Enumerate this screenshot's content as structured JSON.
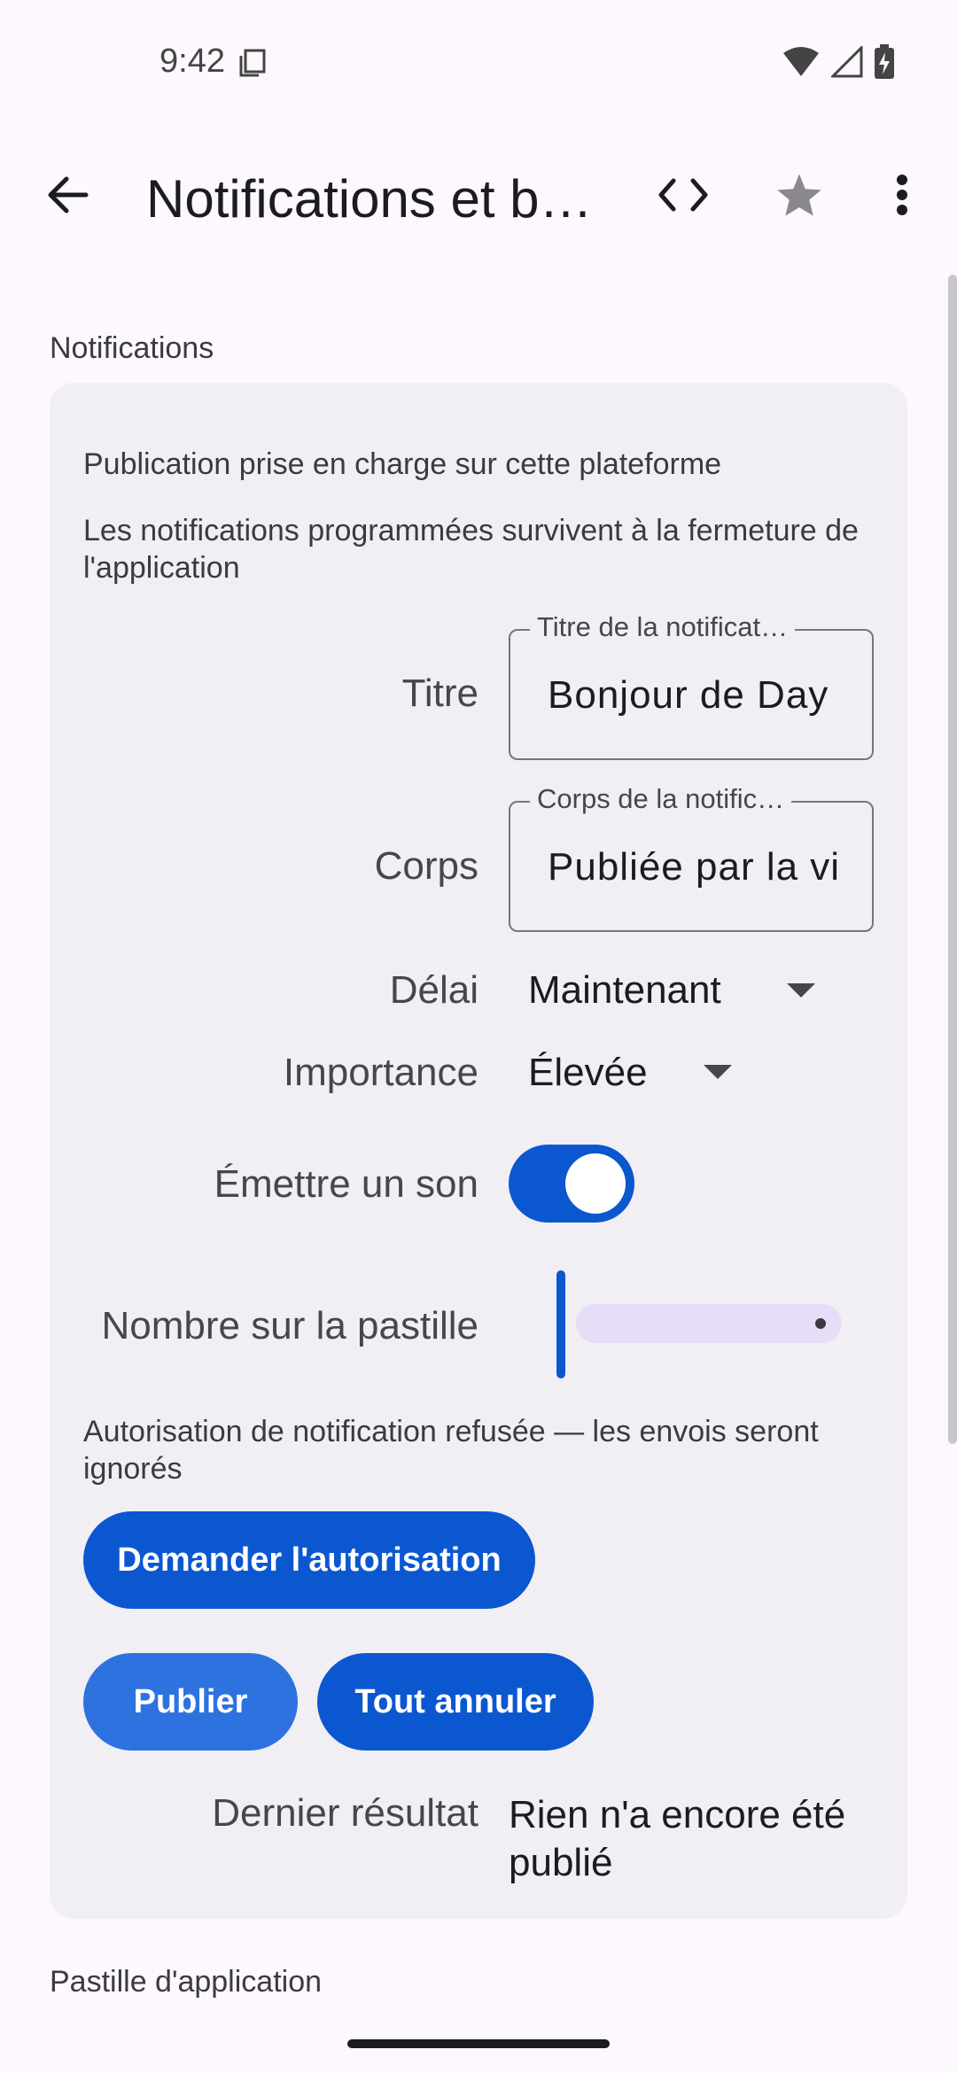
{
  "status_bar": {
    "time": "9:42"
  },
  "app_bar": {
    "title": "Notifications et b…",
    "icons": [
      "back-arrow-icon",
      "code-icon",
      "star-icon",
      "more-vert-icon"
    ]
  },
  "sections": {
    "notifications_label": "Notifications",
    "app_badge_label": "Pastille d'application"
  },
  "card": {
    "support_text": "Publication prise en charge sur cette plateforme",
    "persistence_text": "Les notifications programmées survivent à la fermeture de l'application",
    "title_row": {
      "label": "Titre",
      "field_label": "Titre de la notificat…",
      "value": "Bonjour de Day"
    },
    "body_row": {
      "label": "Corps",
      "field_label": "Corps de la notific…",
      "value": "Publiée par la vi"
    },
    "delay_row": {
      "label": "Délai",
      "value": "Maintenant"
    },
    "importance_row": {
      "label": "Importance",
      "value": "Élevée"
    },
    "sound_row": {
      "label": "Émettre un son",
      "on": true
    },
    "badge_row": {
      "label": "Nombre sur la pastille",
      "value_fraction": 0
    },
    "permission_text": "Autorisation de notification refusée — les envois seront ignorés",
    "request_button": "Demander l'autorisation",
    "publish_button": "Publier",
    "cancel_all_button": "Tout annuler",
    "last_result": {
      "label": "Dernier résultat",
      "value": "Rien n'a encore été publié"
    }
  },
  "colors": {
    "primary": "#0B57D0",
    "background": "#FCF8FD",
    "card": "#F1EEF4"
  }
}
